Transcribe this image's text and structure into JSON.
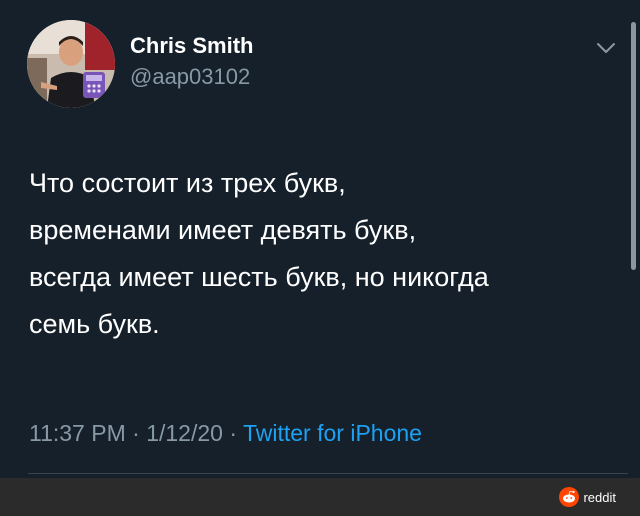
{
  "tweet": {
    "author_name": "Chris Smith",
    "author_handle": "@aap03102",
    "text_lines": [
      "Что состоит из трех букв,",
      "временами имеет девять букв,",
      "всегда имеет шесть букв, но никогда",
      "семь букв."
    ],
    "time": "11:37 PM",
    "separator": " · ",
    "date": "1/12/20",
    "source": "Twitter for iPhone"
  },
  "icons": {
    "caret": "chevron-down-icon",
    "watermark": "reddit-logo-icon"
  },
  "watermark": {
    "label": "reddit"
  },
  "colors": {
    "background": "#15202b",
    "secondary_text": "#8899a6",
    "accent": "#1da1f2",
    "footer": "#2b2b2b",
    "reddit": "#ff4500"
  }
}
